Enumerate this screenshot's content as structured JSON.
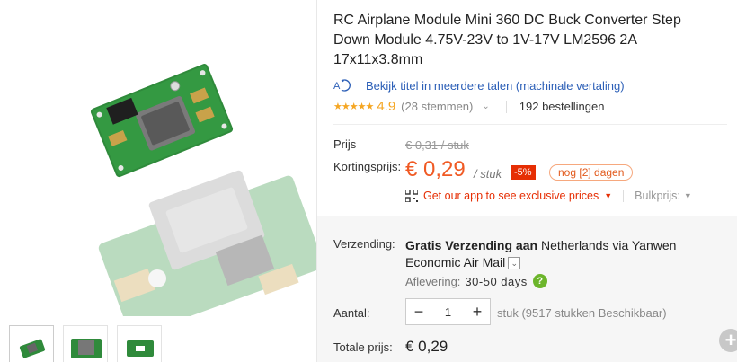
{
  "product": {
    "title": "RC Airplane Module Mini 360 DC Buck Converter Step Down Module 4.75V-23V to 1V-17V LM2596 2A 17x11x3.8mm",
    "translate_link": "Bekijk titel in meerdere talen (machinale vertaling)",
    "rating": "4.9",
    "stars": "★★★★★",
    "votes": "(28 stemmen)",
    "orders": "192 bestellingen"
  },
  "pricing": {
    "price_label": "Prijs",
    "old_price": "€ 0,31 / stuk",
    "discount_label": "Kortingsprijs:",
    "new_price": "€ 0,29",
    "per_unit": "/ stuk",
    "discount": "-5%",
    "days_badge": "nog [2] dagen",
    "app_link": "Get our app to see exclusive prices",
    "bulk": "Bulkprijs:"
  },
  "shipping": {
    "label": "Verzending:",
    "text_bold": "Gratis Verzending aan",
    "text_rest": " Netherlands via Yanwen Economic Air Mail",
    "delivery_label": "Aflevering:",
    "delivery_days": "30-50 days"
  },
  "quantity": {
    "label": "Aantal:",
    "value": "1",
    "stock": "stuk (9517 stukken Beschikbaar)"
  },
  "total": {
    "label": "Totale prijs:",
    "value": "€ 0,29"
  },
  "colors": {
    "accent": "#f05a24",
    "discount_bg": "#e62e04",
    "link": "#2c5fb7",
    "pcb_green": "#2f8a3b"
  },
  "icons": {
    "translate": "translate-icon",
    "qr": "qr-code-icon",
    "help": "help-icon",
    "fab": "plus-icon"
  }
}
